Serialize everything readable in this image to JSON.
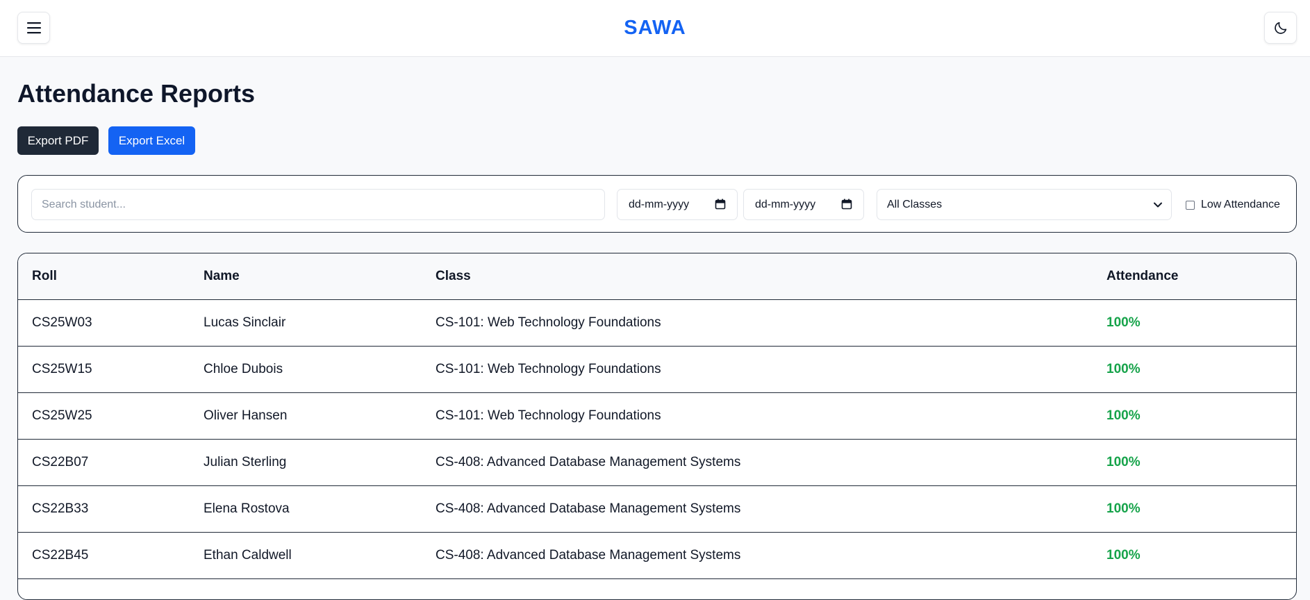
{
  "header": {
    "brand": "SAWA",
    "menu_icon": "hamburger-menu-icon",
    "theme_icon": "moon-icon"
  },
  "page": {
    "title": "Attendance Reports"
  },
  "actions": {
    "export_pdf": "Export PDF",
    "export_excel": "Export Excel"
  },
  "filters": {
    "search_placeholder": "Search student...",
    "date_from": "dd-mm-yyyy",
    "date_to": "dd-mm-yyyy",
    "class_selected": "All Classes",
    "low_attendance_label": "Low Attendance",
    "low_attendance_checked": false
  },
  "table": {
    "columns": [
      "Roll",
      "Name",
      "Class",
      "Attendance"
    ],
    "rows": [
      {
        "roll": "CS25W03",
        "name": "Lucas Sinclair",
        "class": "CS-101: Web Technology Foundations",
        "attendance": "100%"
      },
      {
        "roll": "CS25W15",
        "name": "Chloe Dubois",
        "class": "CS-101: Web Technology Foundations",
        "attendance": "100%"
      },
      {
        "roll": "CS25W25",
        "name": "Oliver Hansen",
        "class": "CS-101: Web Technology Foundations",
        "attendance": "100%"
      },
      {
        "roll": "CS22B07",
        "name": "Julian Sterling",
        "class": "CS-408: Advanced Database Management Systems",
        "attendance": "100%"
      },
      {
        "roll": "CS22B33",
        "name": "Elena Rostova",
        "class": "CS-408: Advanced Database Management Systems",
        "attendance": "100%"
      },
      {
        "roll": "CS22B45",
        "name": "Ethan Caldwell",
        "class": "CS-408: Advanced Database Management Systems",
        "attendance": "100%"
      }
    ]
  },
  "colors": {
    "brand": "#1463f3",
    "dark_button": "#1f2937",
    "attendance_good": "#16a34a"
  }
}
